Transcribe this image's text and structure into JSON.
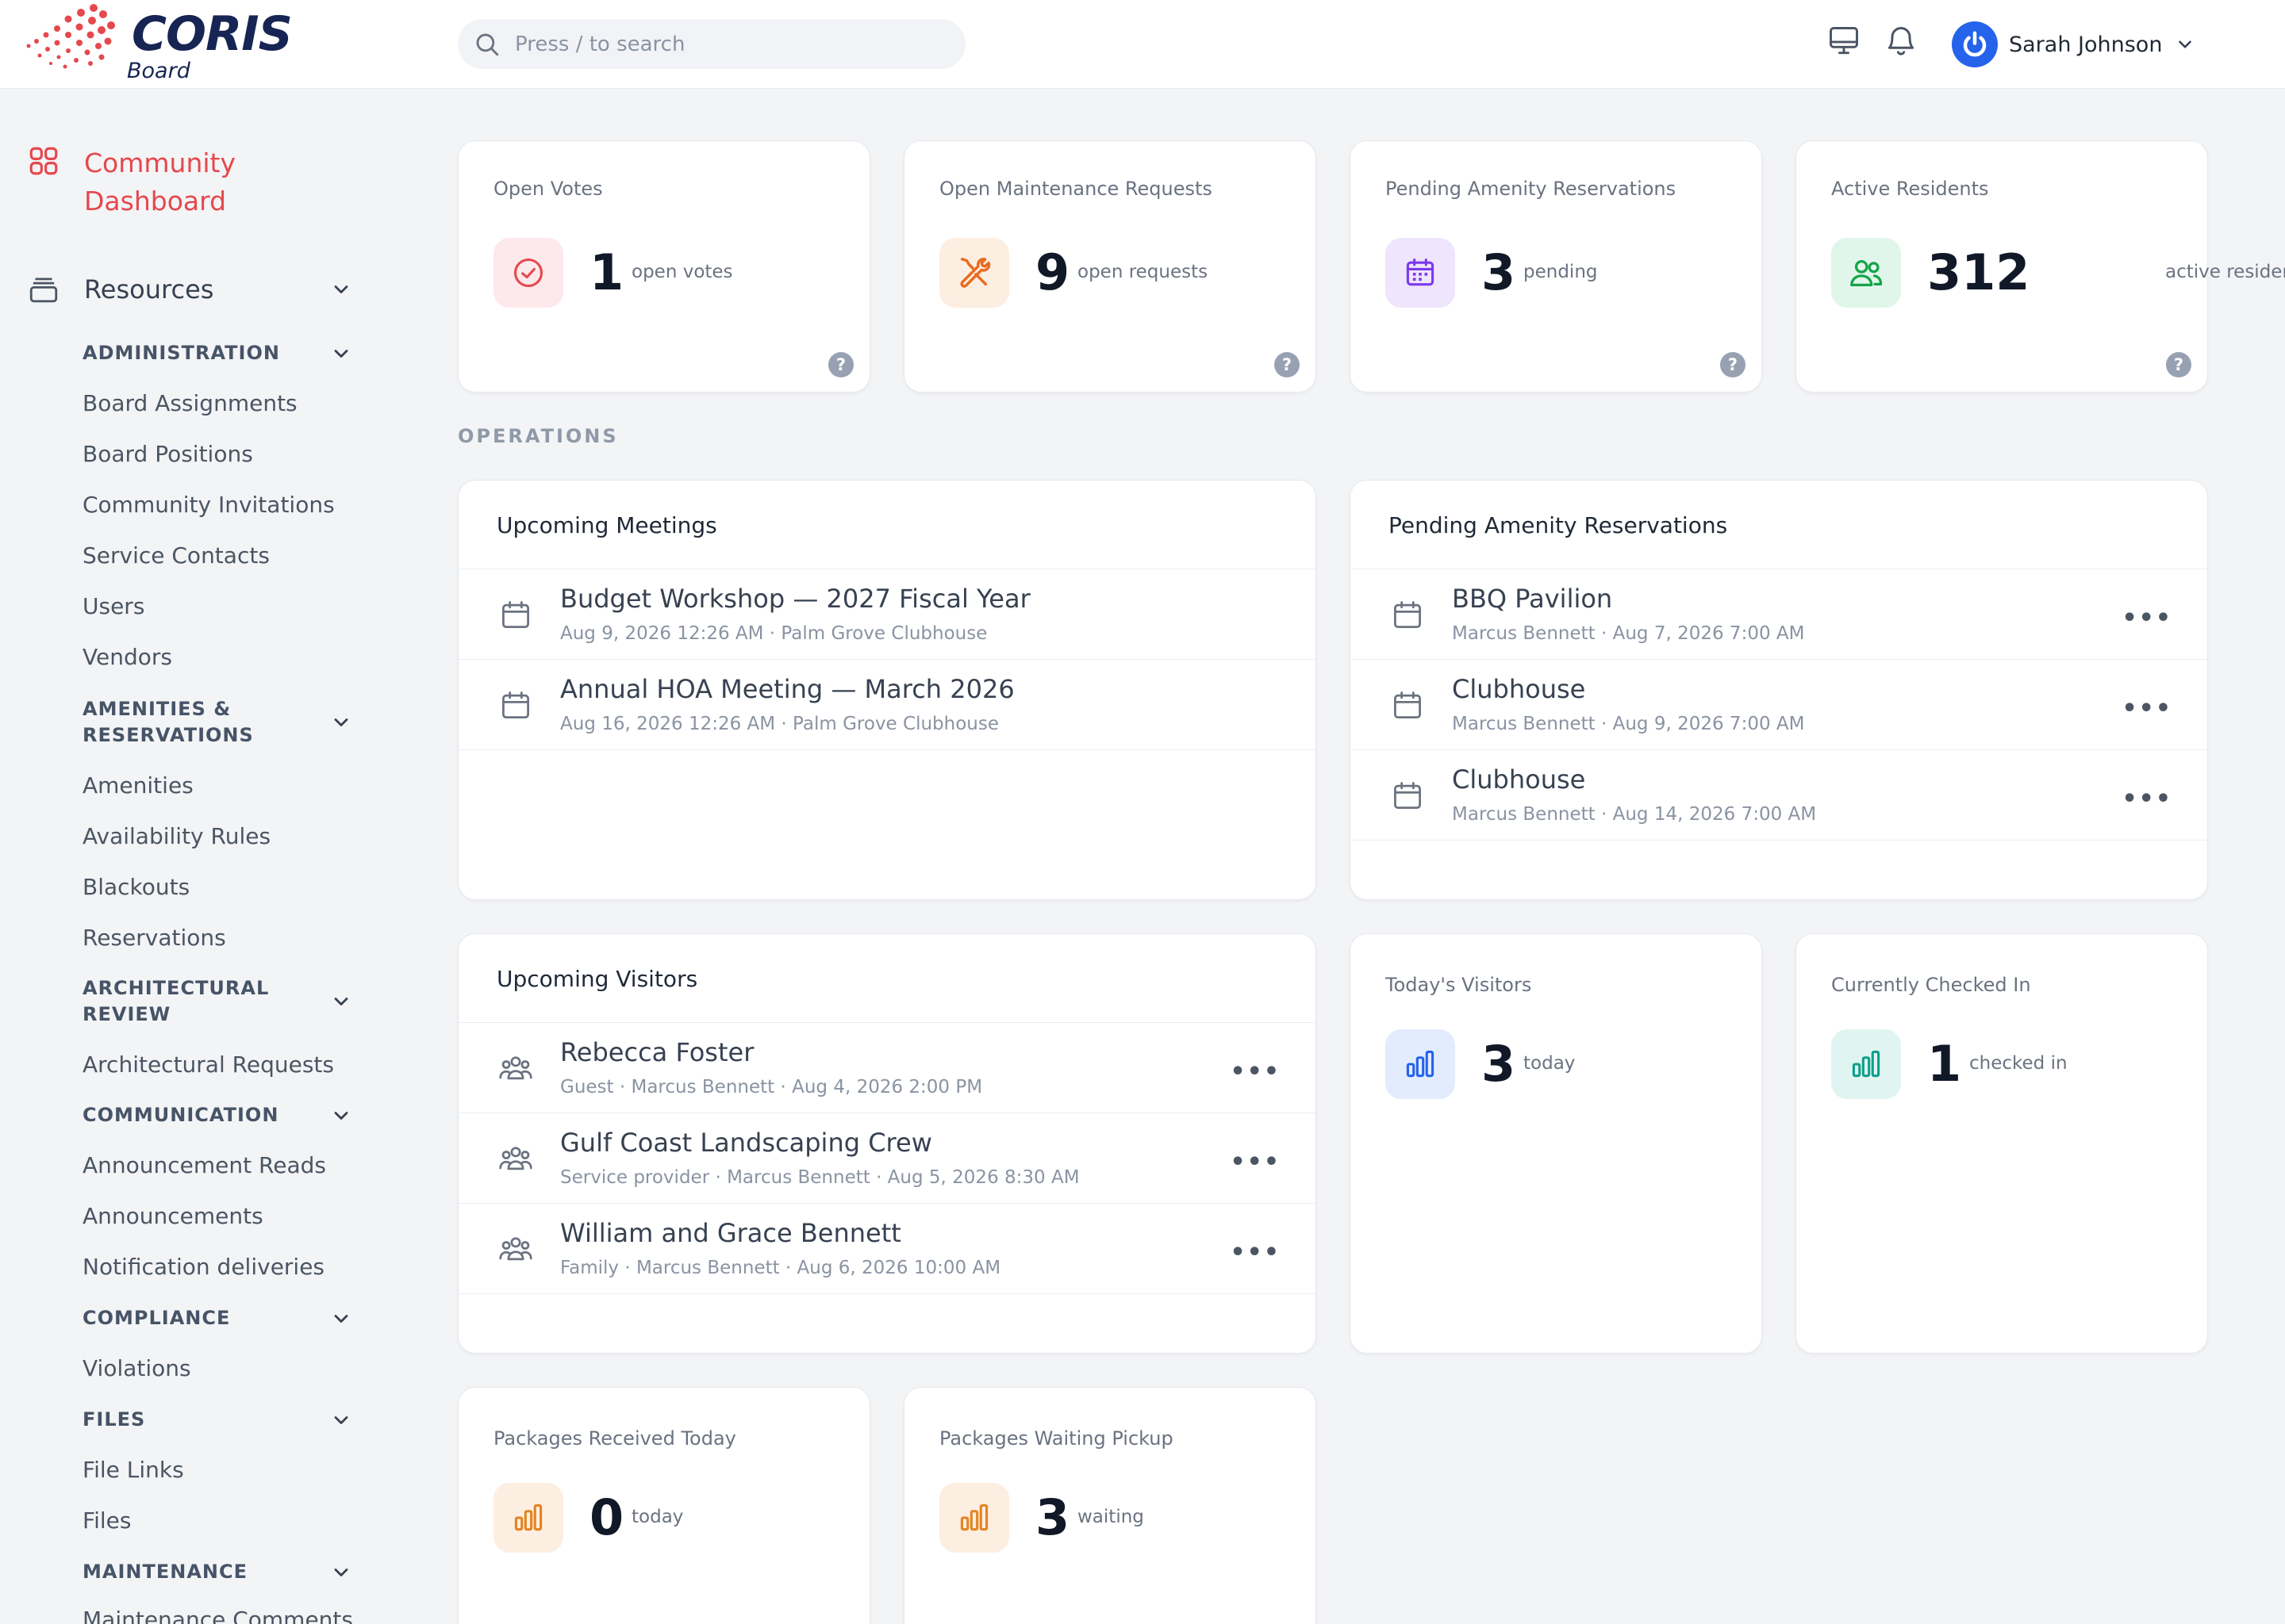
{
  "brand": {
    "name": "CORIS",
    "sub": "Board"
  },
  "search": {
    "placeholder": "Press / to search"
  },
  "user": {
    "name": "Sarah Johnson"
  },
  "sidebar": {
    "dashboard": "Community Dashboard",
    "resources": "Resources",
    "sections": [
      {
        "label": "ADMINISTRATION",
        "items": [
          "Board Assignments",
          "Board Positions",
          "Community Invitations",
          "Service Contacts",
          "Users",
          "Vendors"
        ]
      },
      {
        "label": "AMENITIES & RESERVATIONS",
        "items": [
          "Amenities",
          "Availability Rules",
          "Blackouts",
          "Reservations"
        ]
      },
      {
        "label": "ARCHITECTURAL REVIEW",
        "items": [
          "Architectural Requests"
        ]
      },
      {
        "label": "COMMUNICATION",
        "items": [
          "Announcement Reads",
          "Announcements",
          "Notification deliveries"
        ]
      },
      {
        "label": "COMPLIANCE",
        "items": [
          "Violations"
        ]
      },
      {
        "label": "FILES",
        "items": [
          "File Links",
          "Files"
        ]
      },
      {
        "label": "MAINTENANCE",
        "items": [
          "Maintenance Comments"
        ]
      }
    ]
  },
  "stats": [
    {
      "title": "Open Votes",
      "value": "1",
      "unit": "open votes"
    },
    {
      "title": "Open Maintenance Requests",
      "value": "9",
      "unit": "open requests"
    },
    {
      "title": "Pending Amenity Reservations",
      "value": "3",
      "unit": "pending"
    },
    {
      "title": "Active Residents",
      "value": "312",
      "unit": "active residents"
    }
  ],
  "operations_label": "OPERATIONS",
  "meetings": {
    "title": "Upcoming Meetings",
    "rows": [
      {
        "title": "Budget Workshop — 2027 Fiscal Year",
        "sub": "Aug 9, 2026 12:26 AM · Palm Grove Clubhouse"
      },
      {
        "title": "Annual HOA Meeting — March 2026",
        "sub": "Aug 16, 2026 12:26 AM · Palm Grove Clubhouse"
      }
    ]
  },
  "reservations": {
    "title": "Pending Amenity Reservations",
    "rows": [
      {
        "title": "BBQ Pavilion",
        "sub": "Marcus Bennett · Aug 7, 2026 7:00 AM"
      },
      {
        "title": "Clubhouse",
        "sub": "Marcus Bennett · Aug 9, 2026 7:00 AM"
      },
      {
        "title": "Clubhouse",
        "sub": "Marcus Bennett · Aug 14, 2026 7:00 AM"
      }
    ]
  },
  "visitors": {
    "title": "Upcoming Visitors",
    "rows": [
      {
        "title": "Rebecca Foster",
        "sub": "Guest · Marcus Bennett · Aug 4, 2026 2:00 PM"
      },
      {
        "title": "Gulf Coast Landscaping Crew",
        "sub": "Service provider · Marcus Bennett · Aug 5, 2026 8:30 AM"
      },
      {
        "title": "William and Grace Bennett",
        "sub": "Family · Marcus Bennett · Aug 6, 2026 10:00 AM"
      }
    ]
  },
  "visitor_stats": [
    {
      "title": "Today's Visitors",
      "value": "3",
      "unit": "today"
    },
    {
      "title": "Currently Checked In",
      "value": "1",
      "unit": "checked in"
    }
  ],
  "package_stats": [
    {
      "title": "Packages Received Today",
      "value": "0",
      "unit": "today"
    },
    {
      "title": "Packages Waiting Pickup",
      "value": "3",
      "unit": "waiting"
    }
  ],
  "more_glyph": "•••",
  "help_glyph": "?",
  "colors": {
    "accent": "#e5484d",
    "primary": "#2563eb",
    "navy": "#172554"
  }
}
